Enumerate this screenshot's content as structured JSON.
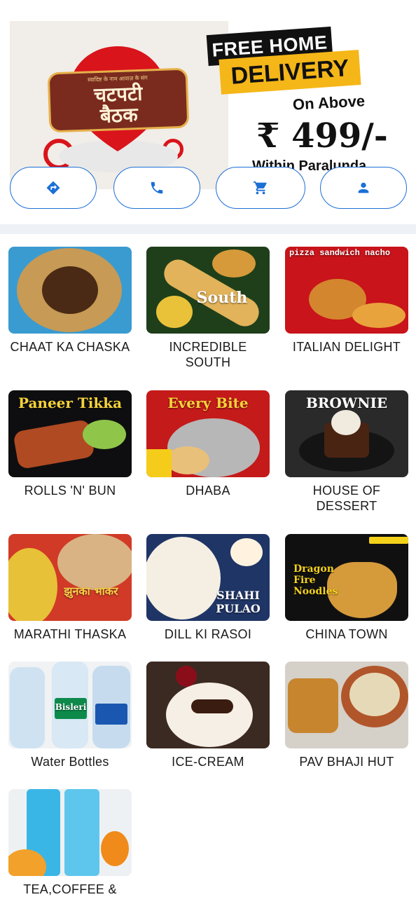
{
  "banner": {
    "logo_tagline": "स्वादिष्ट के नाम आवाज़ के संग",
    "logo_name_line1": "चटपटी",
    "logo_name_line2": "बैठक",
    "promo_line1": "FREE HOME",
    "promo_line2": "DELIVERY",
    "promo_line3": "On Above",
    "promo_price": "₹ 499/-",
    "promo_line4": "Within Paralunda",
    "colors": {
      "accent_yellow": "#f5b618",
      "logo_red": "#d9141b",
      "logo_brown": "#7a2b1e"
    }
  },
  "actions": [
    {
      "icon": "directions-icon",
      "label": "Directions"
    },
    {
      "icon": "phone-icon",
      "label": "Call"
    },
    {
      "icon": "cart-icon",
      "label": "Cart"
    },
    {
      "icon": "person-icon",
      "label": "Profile"
    }
  ],
  "accent_color": "#1c6fd6",
  "categories": [
    {
      "label": "CHAAT KA CHASKA",
      "overlay": ""
    },
    {
      "label": "INCREDIBLE SOUTH",
      "overlay": "South"
    },
    {
      "label": "ITALIAN DELIGHT",
      "overlay": "pizza sandwich nacho"
    },
    {
      "label": "ROLLS 'N' BUN",
      "overlay": "Paneer Tikka"
    },
    {
      "label": "DHABA",
      "overlay": "Every Bite"
    },
    {
      "label": "HOUSE OF DESSERT",
      "overlay": "BROWNIE"
    },
    {
      "label": "MARATHI THASKA",
      "overlay": "झुनका भाकर"
    },
    {
      "label": "DILL KI RASOI",
      "overlay": "SHAHI PULAO"
    },
    {
      "label": "CHINA TOWN",
      "overlay": "Dragon Fire Noodles"
    },
    {
      "label": "Water Bottles",
      "overlay": "Bisleri"
    },
    {
      "label": "ICE-CREAM",
      "overlay": ""
    },
    {
      "label": "PAV BHAJI HUT",
      "overlay": ""
    },
    {
      "label": "TEA,COFFEE &",
      "overlay": ""
    }
  ]
}
